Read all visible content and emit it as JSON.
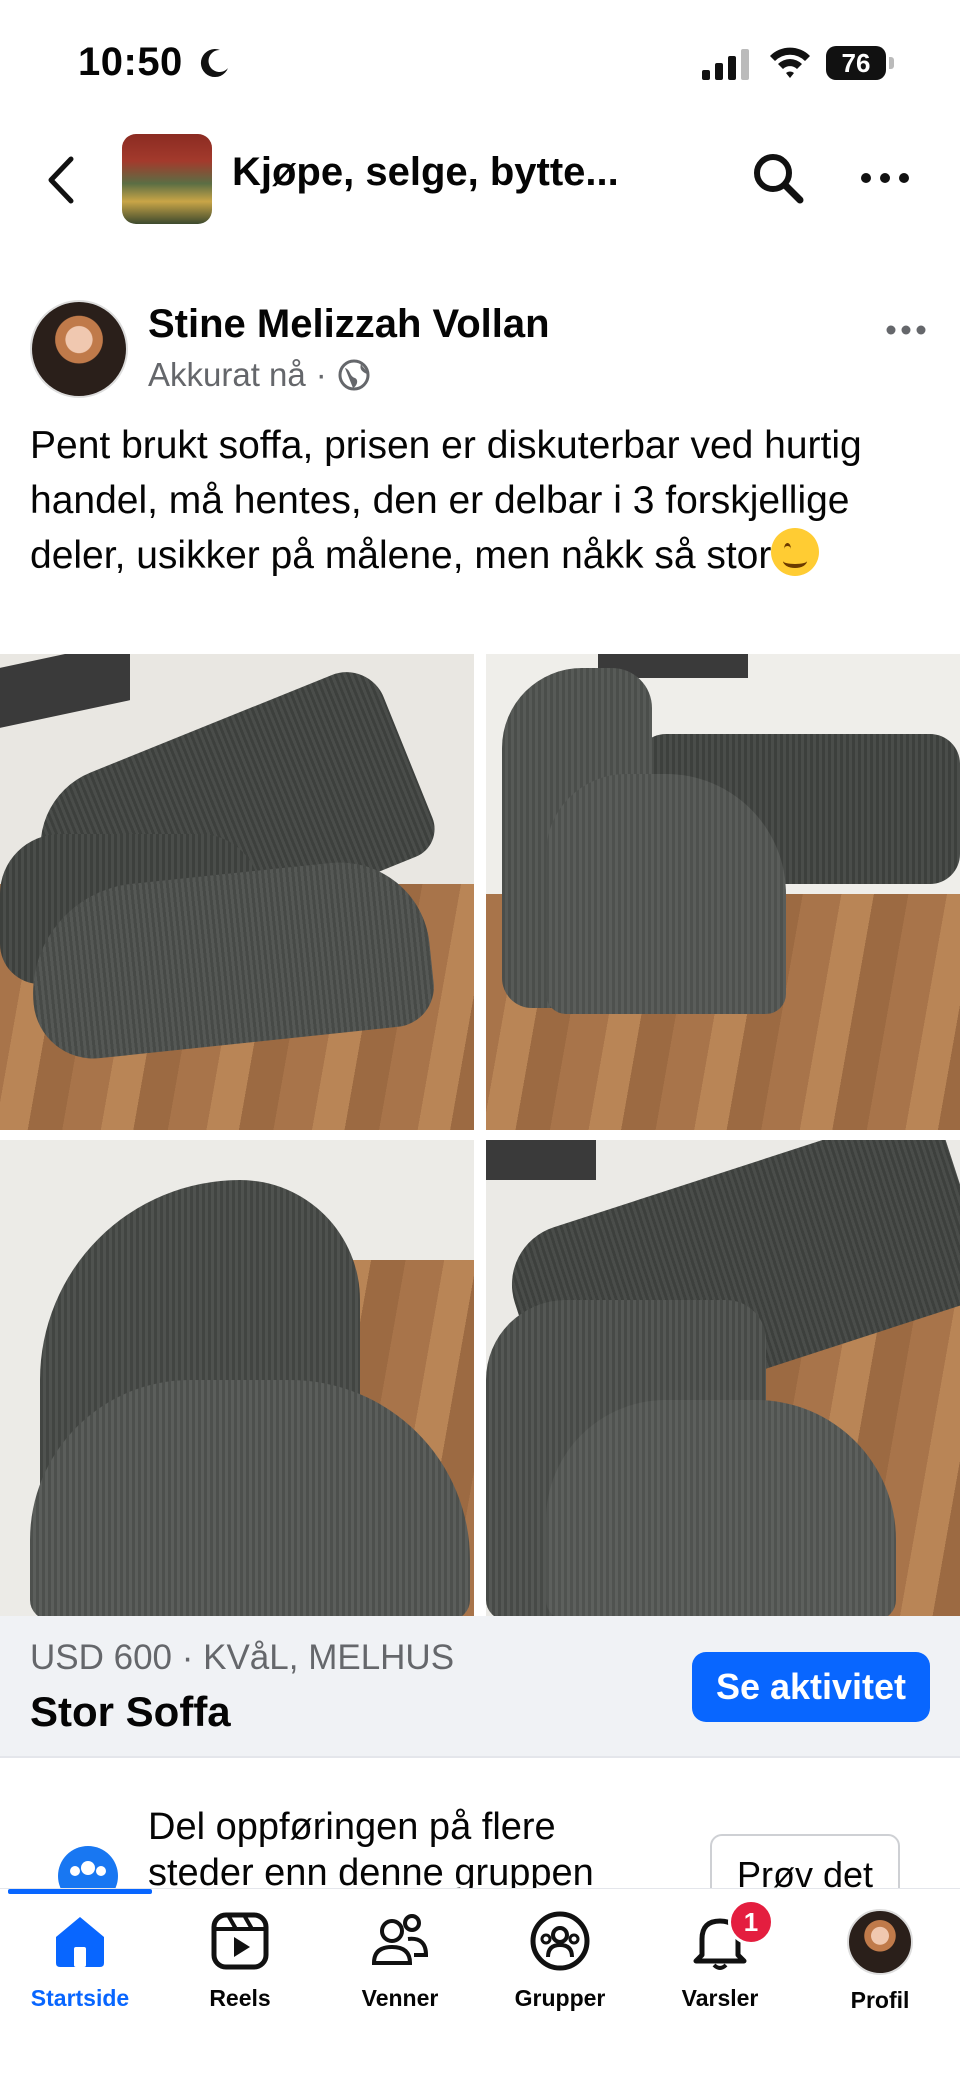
{
  "status_bar": {
    "time": "10:50",
    "battery": "76"
  },
  "header": {
    "group_title": "Kjøpe, selge, bytte..."
  },
  "post": {
    "author": "Stine Melizzah Vollan",
    "time": "Akkurat nå",
    "separator": "·",
    "text": "Pent brukt soffa, prisen er diskuterbar ved hurtig handel, må hentes, den er delbar i 3 forskjellige deler, usikker på målene, men nåkk så stor"
  },
  "listing": {
    "price_location": "USD 600 · KVåL, MELHUS",
    "title": "Stor Soffa",
    "action_label": "Se aktivitet"
  },
  "promo": {
    "text": "Del oppføringen på flere steder enn denne gruppen",
    "button_label": "Prøv det"
  },
  "tabbar": {
    "tabs": [
      {
        "label": "Startside"
      },
      {
        "label": "Reels"
      },
      {
        "label": "Venner"
      },
      {
        "label": "Grupper"
      },
      {
        "label": "Varsler"
      },
      {
        "label": "Profil"
      }
    ],
    "notifications_badge": "1",
    "active_tab": "Startside"
  },
  "colors": {
    "accent": "#0866ff",
    "badge": "#e41e3f",
    "muted": "#65676b"
  }
}
